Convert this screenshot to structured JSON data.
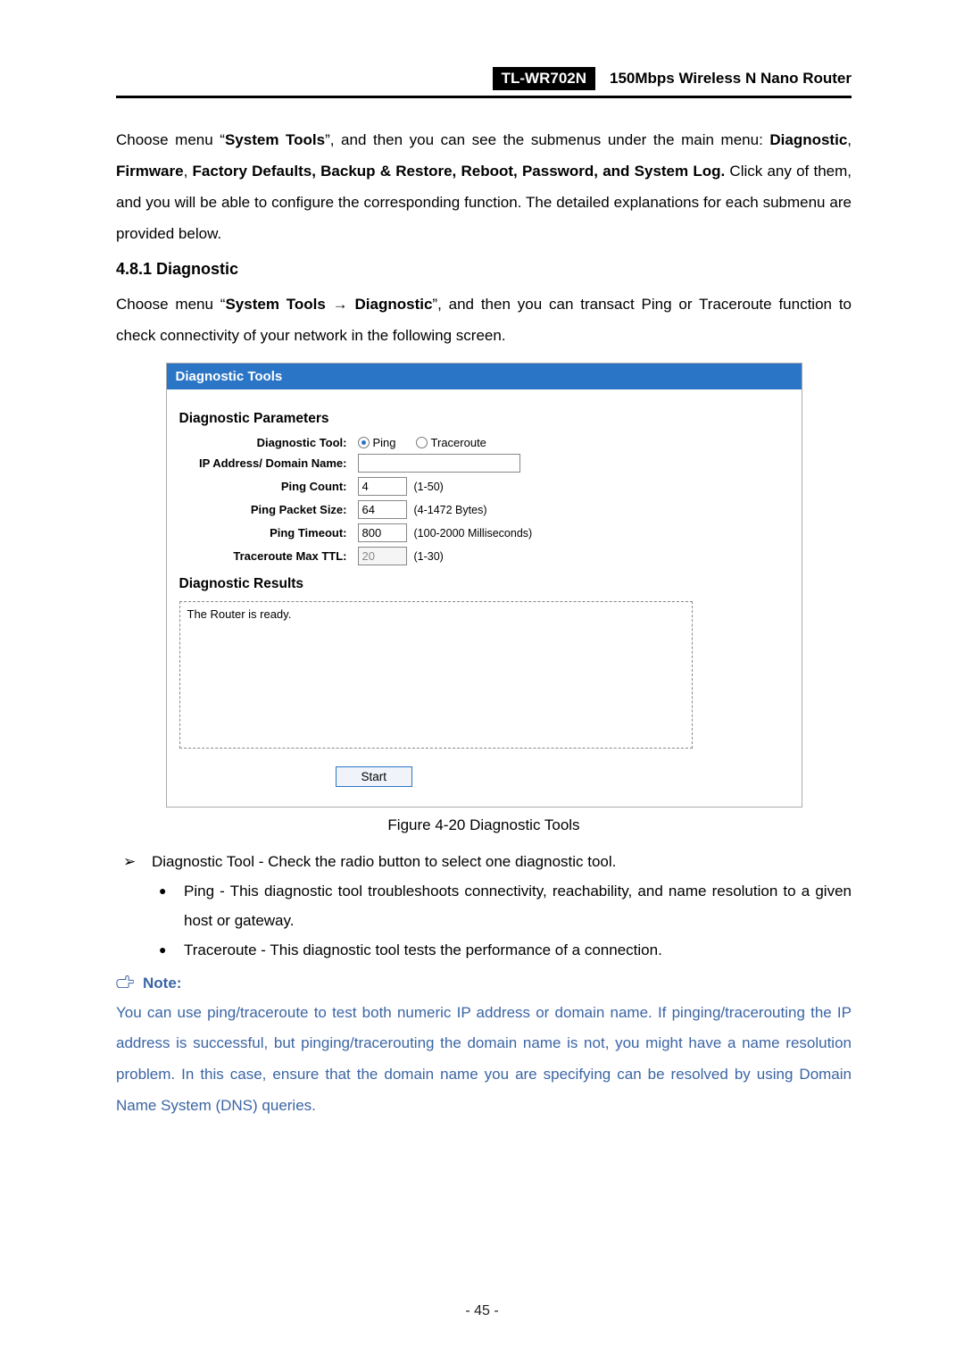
{
  "header": {
    "model": "TL-WR702N",
    "desc": "150Mbps Wireless N Nano Router"
  },
  "intro": {
    "part1": "Choose menu “",
    "bold1": "System Tools",
    "part2": "”, and then you can see the submenus under the main menu: ",
    "bold2": "Diagnostic",
    "comma1": ", ",
    "bold3": "Firmware",
    "comma2": ", ",
    "bold4": "Factory Defaults, Backup & Restore, Reboot, Password, and System Log.",
    "part3": " Click any of them, and you will be able to configure the corresponding function. The detailed explanations for each submenu are provided below."
  },
  "section_heading": "4.8.1  Diagnostic",
  "section_intro": {
    "p1": "Choose menu “",
    "b1": "System Tools",
    "arrow": " → ",
    "b2": "Diagnostic",
    "p2": "”, and then you can transact Ping or Traceroute function to check connectivity of your network in the following screen."
  },
  "screenshot": {
    "title": "Diagnostic Tools",
    "params_heading": "Diagnostic Parameters",
    "labels": {
      "tool": "Diagnostic Tool:",
      "ip": "IP Address/ Domain Name:",
      "count": "Ping Count:",
      "packet": "Ping Packet Size:",
      "timeout": "Ping Timeout:",
      "ttl": "Traceroute Max TTL:"
    },
    "radio": {
      "ping": "Ping",
      "traceroute": "Traceroute"
    },
    "values": {
      "ip": "",
      "count": "4",
      "packet": "64",
      "timeout": "800",
      "ttl": "20"
    },
    "hints": {
      "count": "(1-50)",
      "packet": "(4-1472 Bytes)",
      "timeout": "(100-2000 Milliseconds)",
      "ttl": "(1-30)"
    },
    "results_heading": "Diagnostic Results",
    "results_text": "The Router is ready.",
    "start": "Start"
  },
  "caption": "Figure 4-20   Diagnostic Tools",
  "list": {
    "main_bold": "Diagnostic Tool -",
    "main_text": " Check the radio button to select one diagnostic tool.",
    "ping_bold": "Ping -",
    "ping_text": " This diagnostic tool troubleshoots connectivity, reachability, and name resolution to a given host or gateway.",
    "tr_bold": "Traceroute -",
    "tr_text": " This diagnostic tool tests the performance of a connection."
  },
  "note": {
    "label": "Note:",
    "text": "You can use ping/traceroute to test both numeric IP address or domain name. If pinging/tracerouting the IP address is successful, but pinging/tracerouting the domain name is not, you might have a name resolution problem. In this case, ensure that the domain name you are specifying can be resolved by using Domain Name System (DNS) queries."
  },
  "page_number": "- 45 -"
}
